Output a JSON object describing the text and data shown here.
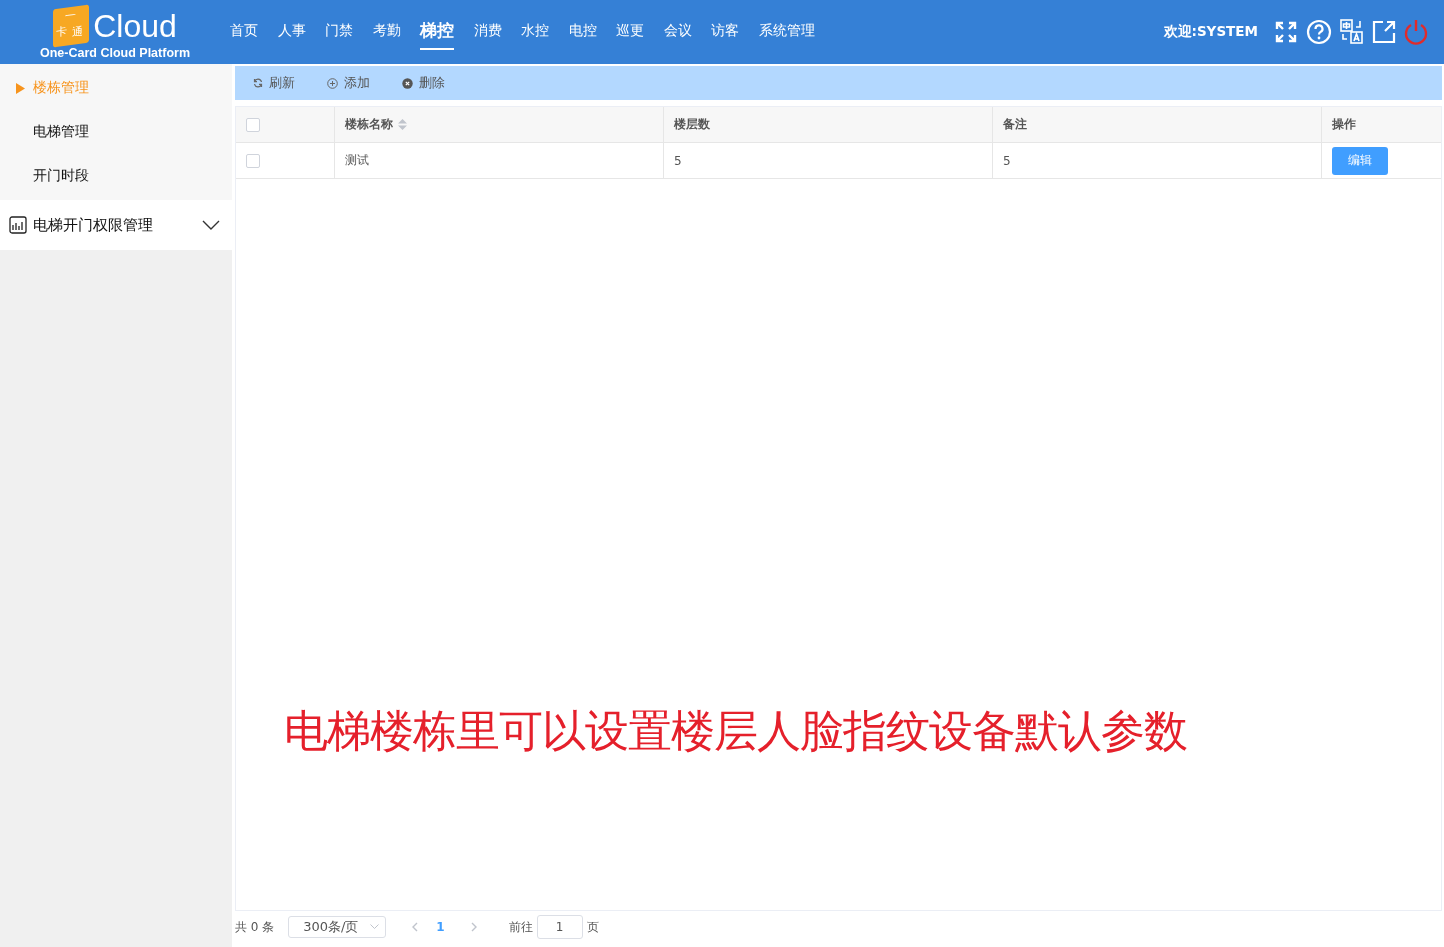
{
  "header": {
    "logo_mark": [
      "一",
      "卡",
      "通"
    ],
    "logo_text": "Cloud",
    "platform": "One-Card Cloud Platform",
    "nav": [
      {
        "label": "首页",
        "selected": false
      },
      {
        "label": "人事",
        "selected": false
      },
      {
        "label": "门禁",
        "selected": false
      },
      {
        "label": "考勤",
        "selected": false
      },
      {
        "label": "梯控",
        "selected": true
      },
      {
        "label": "消费",
        "selected": false
      },
      {
        "label": "水控",
        "selected": false
      },
      {
        "label": "电控",
        "selected": false
      },
      {
        "label": "巡更",
        "selected": false
      },
      {
        "label": "会议",
        "selected": false
      },
      {
        "label": "访客",
        "selected": false
      },
      {
        "label": "系统管理",
        "selected": false
      }
    ],
    "welcome": "欢迎:SYSTEM"
  },
  "sidebar": {
    "items": [
      {
        "label": "楼栋管理",
        "selected": true
      },
      {
        "label": "电梯管理",
        "selected": false
      },
      {
        "label": "开门时段",
        "selected": false
      }
    ],
    "groups": [
      {
        "label": "电梯开门权限管理",
        "expanded": false
      }
    ]
  },
  "toolbar": [
    {
      "kind": "refresh",
      "label": "刷新"
    },
    {
      "kind": "add",
      "label": "添加"
    },
    {
      "kind": "delete",
      "label": "删除"
    }
  ],
  "table": {
    "all_checked": false,
    "columns": [
      "楼栋名称",
      "楼层数",
      "备注",
      "操作"
    ],
    "rows": [
      {
        "checked": false,
        "cells": [
          "测试",
          "5",
          "5"
        ],
        "action": "编辑"
      }
    ]
  },
  "pagination": {
    "total": "共 0 条",
    "page_size": "300条/页",
    "current": "1",
    "goto_label": "前往",
    "goto_value": "1",
    "page_unit": "页"
  },
  "caption": "电梯楼栋里可以设置楼层人脸指纹设备默认参数"
}
